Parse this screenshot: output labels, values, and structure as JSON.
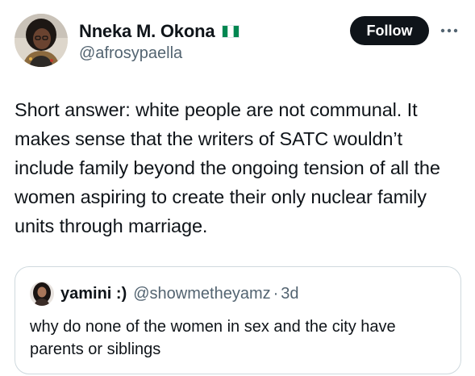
{
  "author": {
    "display_name": "Nneka M. Okona",
    "handle": "@afrosypaella",
    "flag_icon": "nigeria-flag-icon",
    "avatar_icon": "avatar"
  },
  "actions": {
    "follow_label": "Follow",
    "more_icon": "more-horizontal-icon"
  },
  "tweet": {
    "text": "Short answer: white people are not communal. It makes sense that the writers of SATC wouldn’t include family beyond the ongoing tension of all the women aspiring to create their only nuclear family units through marriage."
  },
  "quoted_tweet": {
    "display_name": "yamini :)",
    "handle": "@showmetheyamz",
    "separator": "·",
    "time": "3d",
    "text": "why do none of the women in sex and the city have parents or siblings"
  },
  "colors": {
    "primary_text": "#0f1419",
    "secondary_text": "#536471",
    "border": "#cfd9de",
    "follow_bg": "#0f1419",
    "flag_green": "#008751"
  }
}
